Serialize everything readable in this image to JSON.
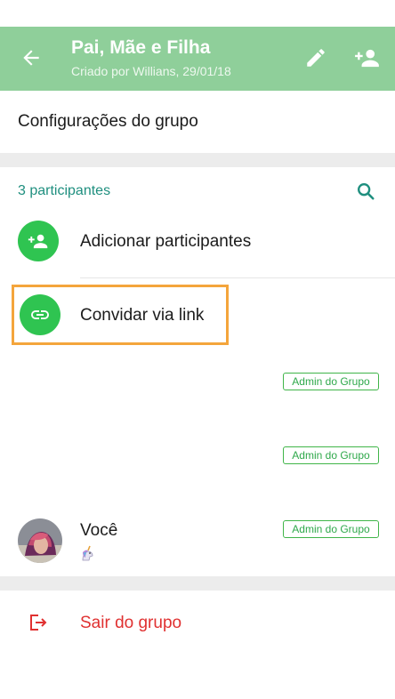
{
  "header": {
    "title": "Pai, Mãe e Filha",
    "subtitle": "Criado por Willians, 29/01/18",
    "back_icon": "arrow-left-icon",
    "edit_icon": "pencil-icon",
    "add_participant_icon": "person-add-icon",
    "color": "#8fcf9a"
  },
  "settings": {
    "label": "Configurações do grupo"
  },
  "participants": {
    "count_label": "3 participantes",
    "search_icon": "search-icon",
    "add_label": "Adicionar participantes",
    "invite_label": "Convidar via link",
    "members": [
      {
        "name": "",
        "status": "",
        "badge": "Admin do Grupo"
      },
      {
        "name": "",
        "status": "",
        "badge": "Admin do Grupo"
      },
      {
        "name": "Você",
        "status": "unicorn",
        "badge": "Admin do Grupo"
      }
    ]
  },
  "exit": {
    "label": "Sair do grupo",
    "color": "#e03131"
  },
  "colors": {
    "accent_green": "#2fc451",
    "highlight": "#f4a53c",
    "teal_text": "#1f8f7f"
  }
}
